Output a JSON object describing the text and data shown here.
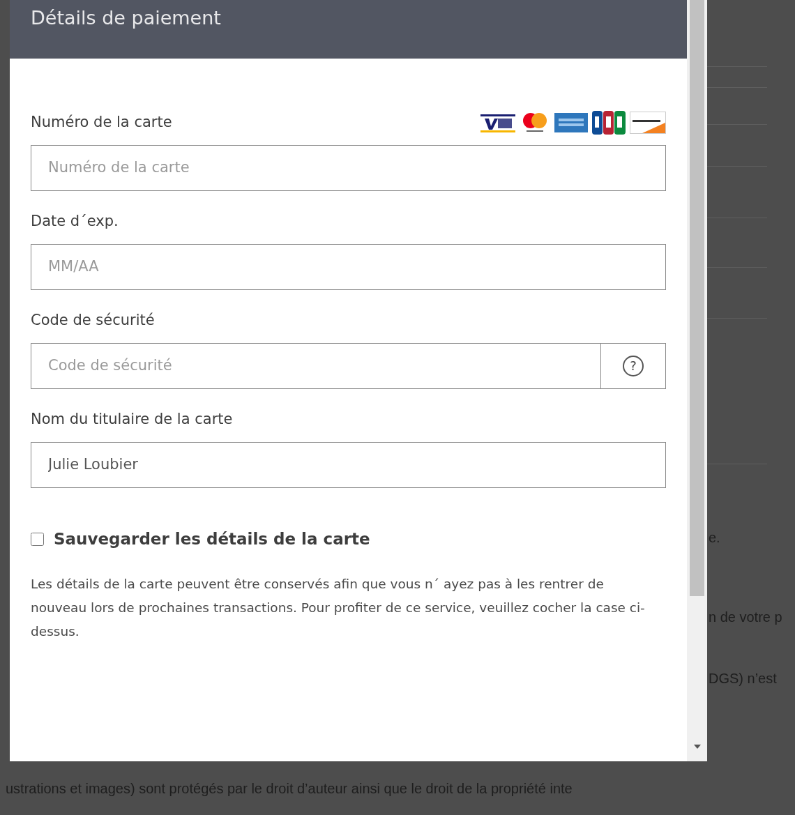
{
  "background": {
    "fragments": [
      {
        "text": "e."
      },
      {
        "text": "n de votre p"
      },
      {
        "text": "DGS) n’est"
      }
    ],
    "bottom_text": "ustrations et images) sont protégés par le droit d’auteur ainsi que le droit de la propriété inte"
  },
  "dialog": {
    "title": "Détails de paiement",
    "fields": [
      {
        "label": "Numéro de la carte",
        "placeholder": "Numéro de la carte",
        "kind": "card"
      },
      {
        "label": "Date d´exp.",
        "placeholder": "MM/AA",
        "kind": "plain"
      },
      {
        "label": "Code de sécurité",
        "placeholder": "Code de sécurité",
        "kind": "help",
        "help": "?"
      },
      {
        "label": "Nom du titulaire de la carte",
        "value": "Julie Loubier",
        "kind": "plain"
      }
    ],
    "save_card": {
      "label": "Sauvegarder les détails de la carte",
      "checked": false
    },
    "note": "Les détails de la carte peuvent être conservés afin que vous n´ ayez pas à les rentrer de nouveau lors de prochaines transactions. Pour profiter de ce service, veuillez cocher la case ci-dessus."
  }
}
